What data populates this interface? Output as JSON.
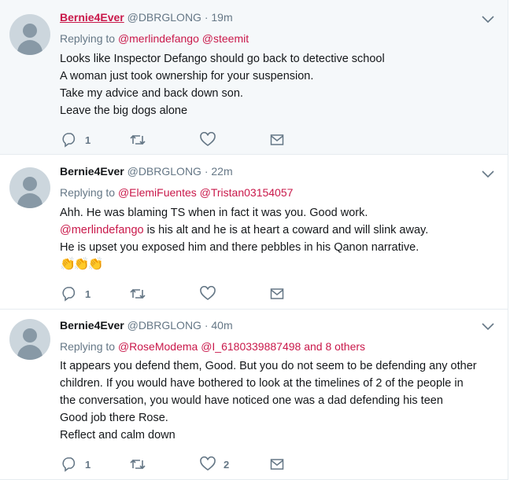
{
  "tweets": [
    {
      "name": "Bernie4Ever",
      "handle": "@DBRGLONG",
      "time": "· 19m",
      "replying_prefix": "Replying to",
      "mentions": [
        "@merlindefango",
        "@steemit"
      ],
      "lines": [
        "Looks like Inspector Defango should go back to detective school",
        "A woman just took ownership for your suspension.",
        "Take my advice and back down son.",
        "Leave the big dogs alone"
      ],
      "reply_count": "1",
      "like_count": ""
    },
    {
      "name": "Bernie4Ever",
      "handle": "@DBRGLONG",
      "time": "· 22m",
      "replying_prefix": "Replying to",
      "mentions": [
        "@ElemiFuentes",
        "@Tristan03154057"
      ],
      "line1": "Ahh. He was blaming TS when in fact it was you. Good work.",
      "line2_mention": "@merlindefango",
      "line2_rest": " is his alt and he is at heart a coward and will slink away.",
      "line3": "He is upset you exposed him and there pebbles in his Qanon narrative.",
      "emoji": "👏👏👏",
      "reply_count": "1",
      "like_count": ""
    },
    {
      "name": "Bernie4Ever",
      "handle": "@DBRGLONG",
      "time": "· 40m",
      "replying_prefix": "Replying to",
      "mentions": [
        "@RoseModema",
        "@I_6180339887498"
      ],
      "others": "and 8 others",
      "lines": [
        "It appears you defend them, Good. But you do not seem to be defending any other",
        "children. If you would have bothered to look at the timelines of 2 of the people in",
        "the conversation, you would have noticed one was a dad defending his teen",
        "Good job there Rose.",
        "Reflect and calm down"
      ],
      "reply_count": "1",
      "like_count": "2"
    }
  ],
  "icons": {
    "reply": "reply-icon",
    "retweet": "retweet-icon",
    "like": "heart-icon",
    "dm": "envelope-icon",
    "menu": "chevron-down-icon"
  }
}
